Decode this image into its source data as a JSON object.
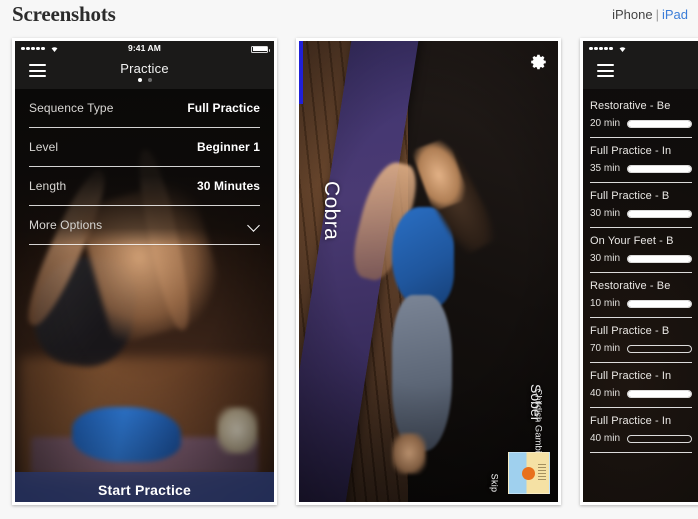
{
  "header": {
    "title": "Screenshots",
    "platform_current": "iPhone",
    "platform_separator": "|",
    "platform_link": "iPad"
  },
  "screen1": {
    "status_bar": {
      "time": "9:41 AM",
      "signal_dots": 5,
      "wifi_icon": "wifi-icon",
      "battery_icon": "battery-icon"
    },
    "nav": {
      "menu_icon": "hamburger-icon",
      "title": "Practice",
      "dots": 2,
      "active_dot": 1
    },
    "options": [
      {
        "label": "Sequence Type",
        "value": "Full Practice"
      },
      {
        "label": "Level",
        "value": "Beginner 1"
      },
      {
        "label": "Length",
        "value": "30 Minutes"
      },
      {
        "label": "More Options",
        "value": "",
        "icon": "chevron-down-icon"
      }
    ],
    "start_button": "Start Practice"
  },
  "screen2": {
    "settings_icon": "gear-icon",
    "pose_name": "Cobra",
    "now_playing": {
      "artist": "Childish Gambino",
      "track": "Sober",
      "skip_label": "Skip",
      "skip_glyph": "▶❘",
      "album_art": "album-art-thumbnail"
    },
    "progress_percent": 15
  },
  "screen3": {
    "status_bar": {
      "signal_dots": 5,
      "wifi_icon": "wifi-icon"
    },
    "nav": {
      "menu_icon": "hamburger-icon"
    },
    "history": [
      {
        "title": "Restorative - Be",
        "duration": "20 min",
        "progress": 100
      },
      {
        "title": "Full Practice - In",
        "duration": "35 min",
        "progress": 100
      },
      {
        "title": "Full Practice - B",
        "duration": "30 min",
        "progress": 100
      },
      {
        "title": "On Your Feet - B",
        "duration": "30 min",
        "progress": 100
      },
      {
        "title": "Restorative - Be",
        "duration": "10 min",
        "progress": 100
      },
      {
        "title": "Full Practice - B",
        "duration": "70 min",
        "progress": 0
      },
      {
        "title": "Full Practice - In",
        "duration": "40 min",
        "progress": 100
      },
      {
        "title": "Full Practice - In",
        "duration": "40 min",
        "progress": 0
      }
    ]
  },
  "colors": {
    "page_background": "#f7f7f7",
    "link": "#3b7dd8",
    "progress_blue": "#2020d8",
    "start_button": "#263568"
  }
}
